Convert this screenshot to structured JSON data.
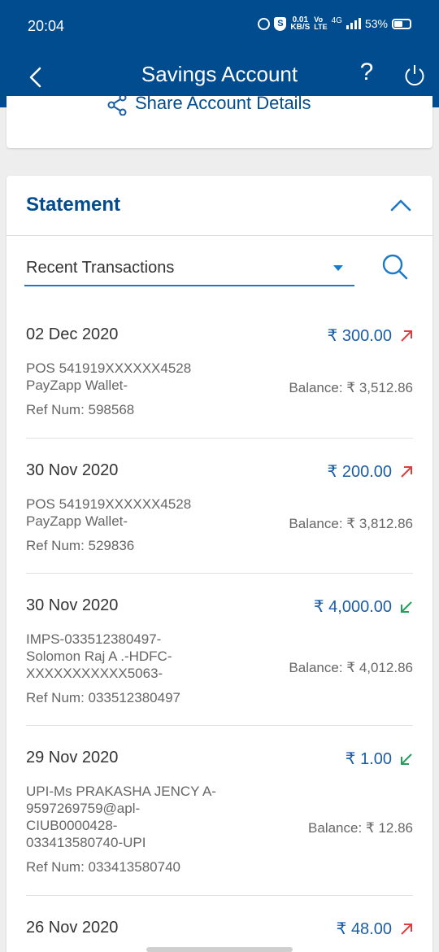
{
  "status_bar": {
    "time": "20:04",
    "shield_glyph": "S",
    "speed_value": "0.01",
    "speed_unit": "KB/S",
    "volte_top": "Vo",
    "volte_bottom": "LTE",
    "network": "4G",
    "battery": "53%"
  },
  "app_bar": {
    "title": "Savings Account",
    "help_label": "?",
    "back_icon": "chevron-left-icon",
    "power_icon": "power-icon"
  },
  "share": {
    "label": "Share Account Details",
    "icon": "share-icon"
  },
  "statement": {
    "title": "Statement",
    "filter_value": "Recent Transactions",
    "search_icon": "search-icon",
    "colors": {
      "accent": "#004c8f",
      "amount": "#1a5da6",
      "debit": "#e23b3b",
      "credit": "#22a05a"
    },
    "transactions": [
      {
        "date": "02 Dec 2020",
        "amount": "₹ 300.00",
        "direction": "debit",
        "description": [
          "POS 541919XXXXXX4528",
          "PayZapp Wallet-"
        ],
        "ref": "Ref Num: 598568",
        "balance": "Balance: ₹ 3,512.86"
      },
      {
        "date": "30 Nov 2020",
        "amount": "₹ 200.00",
        "direction": "debit",
        "description": [
          "POS 541919XXXXXX4528",
          "PayZapp Wallet-"
        ],
        "ref": "Ref Num: 529836",
        "balance": "Balance: ₹ 3,812.86"
      },
      {
        "date": "30 Nov 2020",
        "amount": "₹ 4,000.00",
        "direction": "credit",
        "description": [
          "IMPS-033512380497-",
          "Solomon Raj A .-HDFC-",
          "XXXXXXXXXXX5063-"
        ],
        "ref": "Ref Num: 033512380497",
        "balance": "Balance: ₹ 4,012.86"
      },
      {
        "date": "29 Nov 2020",
        "amount": "₹ 1.00",
        "direction": "credit",
        "description": [
          "UPI-Ms PRAKASHA JENCY A-",
          "9597269759@apl-",
          "CIUB0000428-",
          "033413580740-UPI"
        ],
        "ref": "Ref Num: 033413580740",
        "balance": "Balance: ₹ 12.86"
      },
      {
        "date": "26 Nov 2020",
        "amount": "₹ 48.00",
        "direction": "debit",
        "description": [],
        "ref": "",
        "balance": ""
      }
    ]
  }
}
